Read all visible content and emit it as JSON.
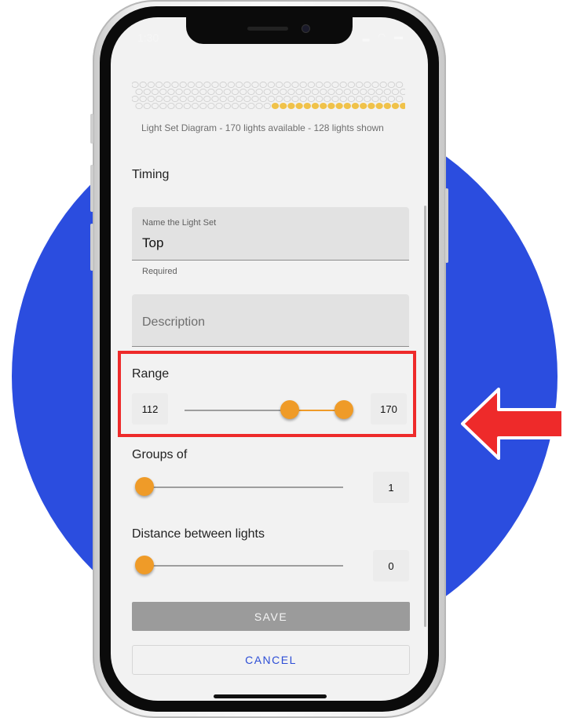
{
  "status_bar": {
    "time": "1:30"
  },
  "diagram": {
    "caption": "Light Set Diagram - 170 lights available - 128 lights shown",
    "highlight_color": "#f0c24a"
  },
  "timing": {
    "title": "Timing"
  },
  "name_field": {
    "label": "Name the Light Set",
    "value": "Top",
    "helper": "Required"
  },
  "description_field": {
    "placeholder": "Description"
  },
  "range": {
    "title": "Range",
    "min_value": "112",
    "max_value": "170",
    "range_max": 170
  },
  "groups": {
    "title": "Groups of",
    "value": "1"
  },
  "distance": {
    "title": "Distance between lights",
    "value": "0"
  },
  "actions": {
    "save_label": "SAVE",
    "cancel_label": "CANCEL"
  },
  "colors": {
    "accent": "#ef9b28",
    "background_circle": "#2b4ddf",
    "callout": "#ee2a2a",
    "link": "#2d4ed6"
  }
}
